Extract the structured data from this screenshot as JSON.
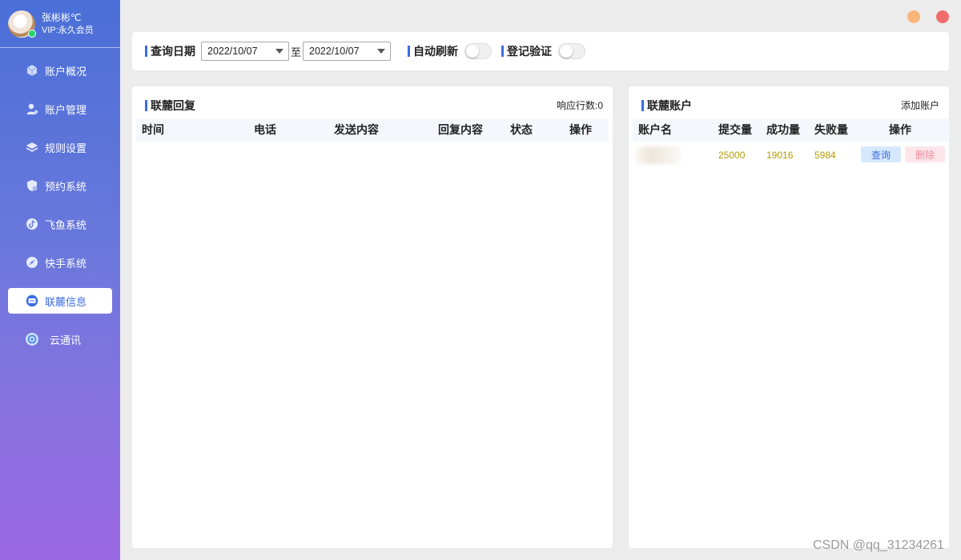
{
  "profile": {
    "name": "张彬彬℃",
    "vip": "VIP:永久会员"
  },
  "sidebar": {
    "items": [
      {
        "label": "账户概况",
        "icon": "cube-icon"
      },
      {
        "label": "账户管理",
        "icon": "user-icon"
      },
      {
        "label": "规则设置",
        "icon": "layers-icon"
      },
      {
        "label": "预约系统",
        "icon": "shield-icon"
      },
      {
        "label": "飞鱼系统",
        "icon": "tiktok-icon"
      },
      {
        "label": "快手系统",
        "icon": "compass-icon"
      },
      {
        "label": "联麓信息",
        "icon": "message-icon"
      },
      {
        "label": "云通讯",
        "icon": "cloud-sync-icon"
      }
    ],
    "active_index": 6
  },
  "filter": {
    "date_label": "查询日期",
    "start_date": "2022/10/07",
    "to_label": "至",
    "end_date": "2022/10/07",
    "auto_refresh_label": "自动刷新",
    "auto_refresh_on": false,
    "verify_label": "登记验证",
    "verify_on": false
  },
  "reply_panel": {
    "title": "联麓回复",
    "count_label": "响应行数:0",
    "columns": [
      "时间",
      "电话",
      "发送内容",
      "回复内容",
      "状态",
      "操作"
    ],
    "rows": []
  },
  "account_panel": {
    "title": "联麓账户",
    "add_label": "添加账户",
    "columns": [
      "账户名",
      "提交量",
      "成功量",
      "失败量",
      "操作"
    ],
    "rows": [
      {
        "submitted": "25000",
        "success": "19016",
        "failed": "5984",
        "query_label": "查询",
        "delete_label": "删除"
      }
    ]
  },
  "colors": {
    "accent": "#3b6de0",
    "value": "#b59b00",
    "min_btn": "#f8b57c",
    "close_btn": "#f26b6b"
  },
  "watermark": "CSDN @qq_31234261"
}
